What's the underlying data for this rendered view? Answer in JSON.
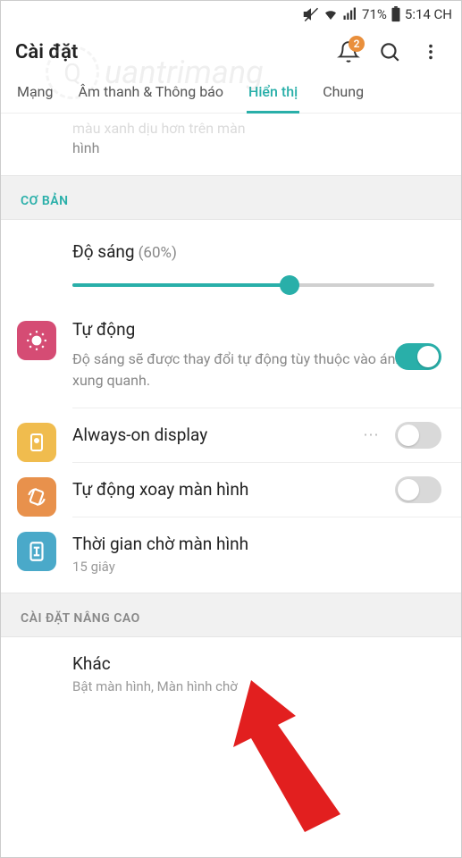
{
  "status": {
    "battery": "71%",
    "time": "5:14 CH"
  },
  "header": {
    "title": "Cài đặt",
    "badge": "2"
  },
  "watermark": "uantrimang",
  "tabs": {
    "t1": "Mạng",
    "t2": "Âm thanh & Thông báo",
    "t3": "Hiển thị",
    "t4": "Chung"
  },
  "partial": {
    "line1": "màu xanh dịu hơn trên màn",
    "line2": "hình"
  },
  "sections": {
    "basic": "CƠ BẢN",
    "advanced": "CÀI ĐẶT NÂNG CAO"
  },
  "brightness": {
    "label": "Độ sáng",
    "pct": "(60%)"
  },
  "auto": {
    "title": "Tự động",
    "desc": "Độ sáng sẽ được thay đổi tự động tùy thuộc vào ánh sáng xung quanh."
  },
  "aod": {
    "title": "Always-on display"
  },
  "rotate": {
    "title": "Tự động xoay màn hình"
  },
  "timeout": {
    "title": "Thời gian chờ màn hình",
    "sub": "15 giây"
  },
  "other": {
    "title": "Khác",
    "sub": "Bật màn hình, Màn hình chờ"
  },
  "colors": {
    "accent": "#29afa9",
    "brightness_icon": "#d54c74",
    "aod_icon": "#f0bc4e",
    "rotate_icon": "#e8914c",
    "timeout_icon": "#4aa9c9",
    "arrow": "#e21f1f"
  }
}
